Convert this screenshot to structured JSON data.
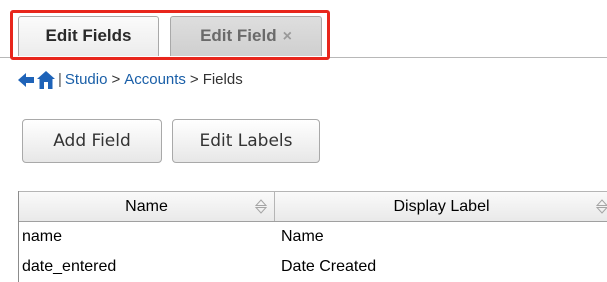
{
  "tabs": [
    {
      "label": "Edit Fields",
      "active": true
    },
    {
      "label": "Edit Field",
      "active": false,
      "close_symbol": "×"
    }
  ],
  "breadcrumb": {
    "back_icon": "arrow-left-icon",
    "home_icon": "home-icon",
    "separator": "|",
    "items": [
      "Studio",
      "Accounts",
      "Fields"
    ],
    "divider": ">"
  },
  "toolbar": {
    "add_field_label": "Add Field",
    "edit_labels_label": "Edit Labels"
  },
  "table": {
    "columns": [
      "Name",
      "Display Label"
    ],
    "sort_icon": "sort-arrows-icon",
    "rows": [
      {
        "name": "name",
        "display_label": "Name"
      },
      {
        "name": "date_entered",
        "display_label": "Date Created"
      }
    ]
  },
  "colors": {
    "highlight": "#e8261c",
    "link": "#1a5fa8",
    "icon_blue": "#1e63b8"
  }
}
